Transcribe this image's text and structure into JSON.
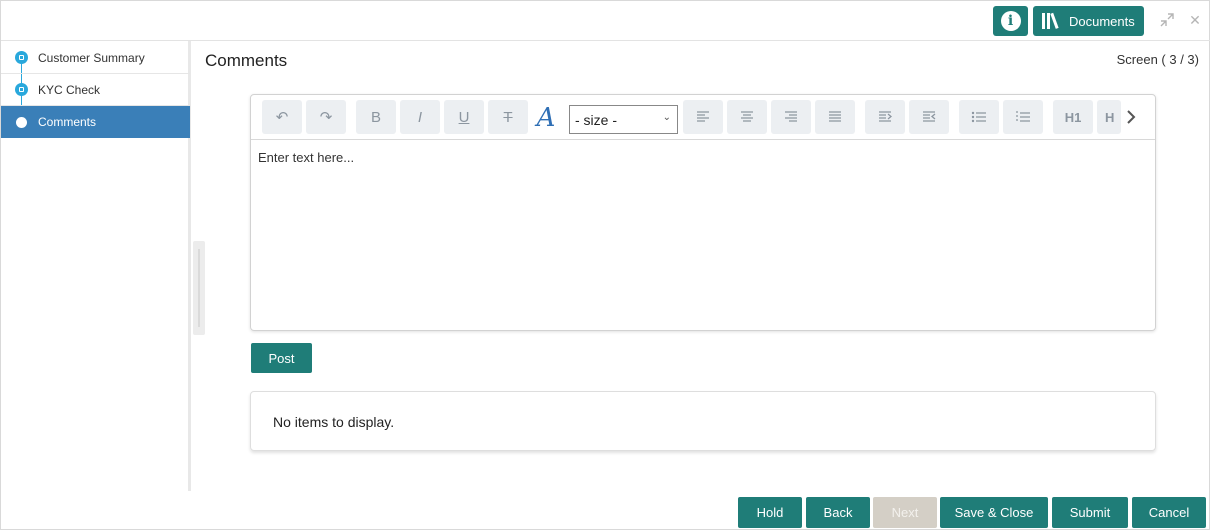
{
  "header": {
    "info_label": "i",
    "documents_label": "Documents",
    "minimize_icon": "↗↙",
    "close_icon": "✕"
  },
  "sidebar": {
    "steps": [
      {
        "label": "Customer Summary",
        "state": "completed"
      },
      {
        "label": "KYC Check",
        "state": "completed"
      },
      {
        "label": "Comments",
        "state": "active"
      }
    ]
  },
  "main": {
    "title": "Comments",
    "screen_indicator": "Screen ( 3 / 3)"
  },
  "editor": {
    "size_select_value": "- size -",
    "placeholder": "Enter text here...",
    "toolbar": {
      "undo": "↶",
      "redo": "↷",
      "bold": "B",
      "italic": "I",
      "underline": "U",
      "strike": "T",
      "font_color": "A",
      "h1": "H1",
      "h2": "H",
      "more": "›"
    }
  },
  "post_label": "Post",
  "comments_list": {
    "empty_text": "No items to display."
  },
  "footer": {
    "hold": "Hold",
    "back": "Back",
    "next": "Next",
    "save_close": "Save & Close",
    "submit": "Submit",
    "cancel": "Cancel"
  },
  "colors": {
    "primary": "#1f7d78",
    "active_step": "#3a7fb8",
    "step_dot": "#29a8dc",
    "disabled": "#d4cfc6"
  }
}
